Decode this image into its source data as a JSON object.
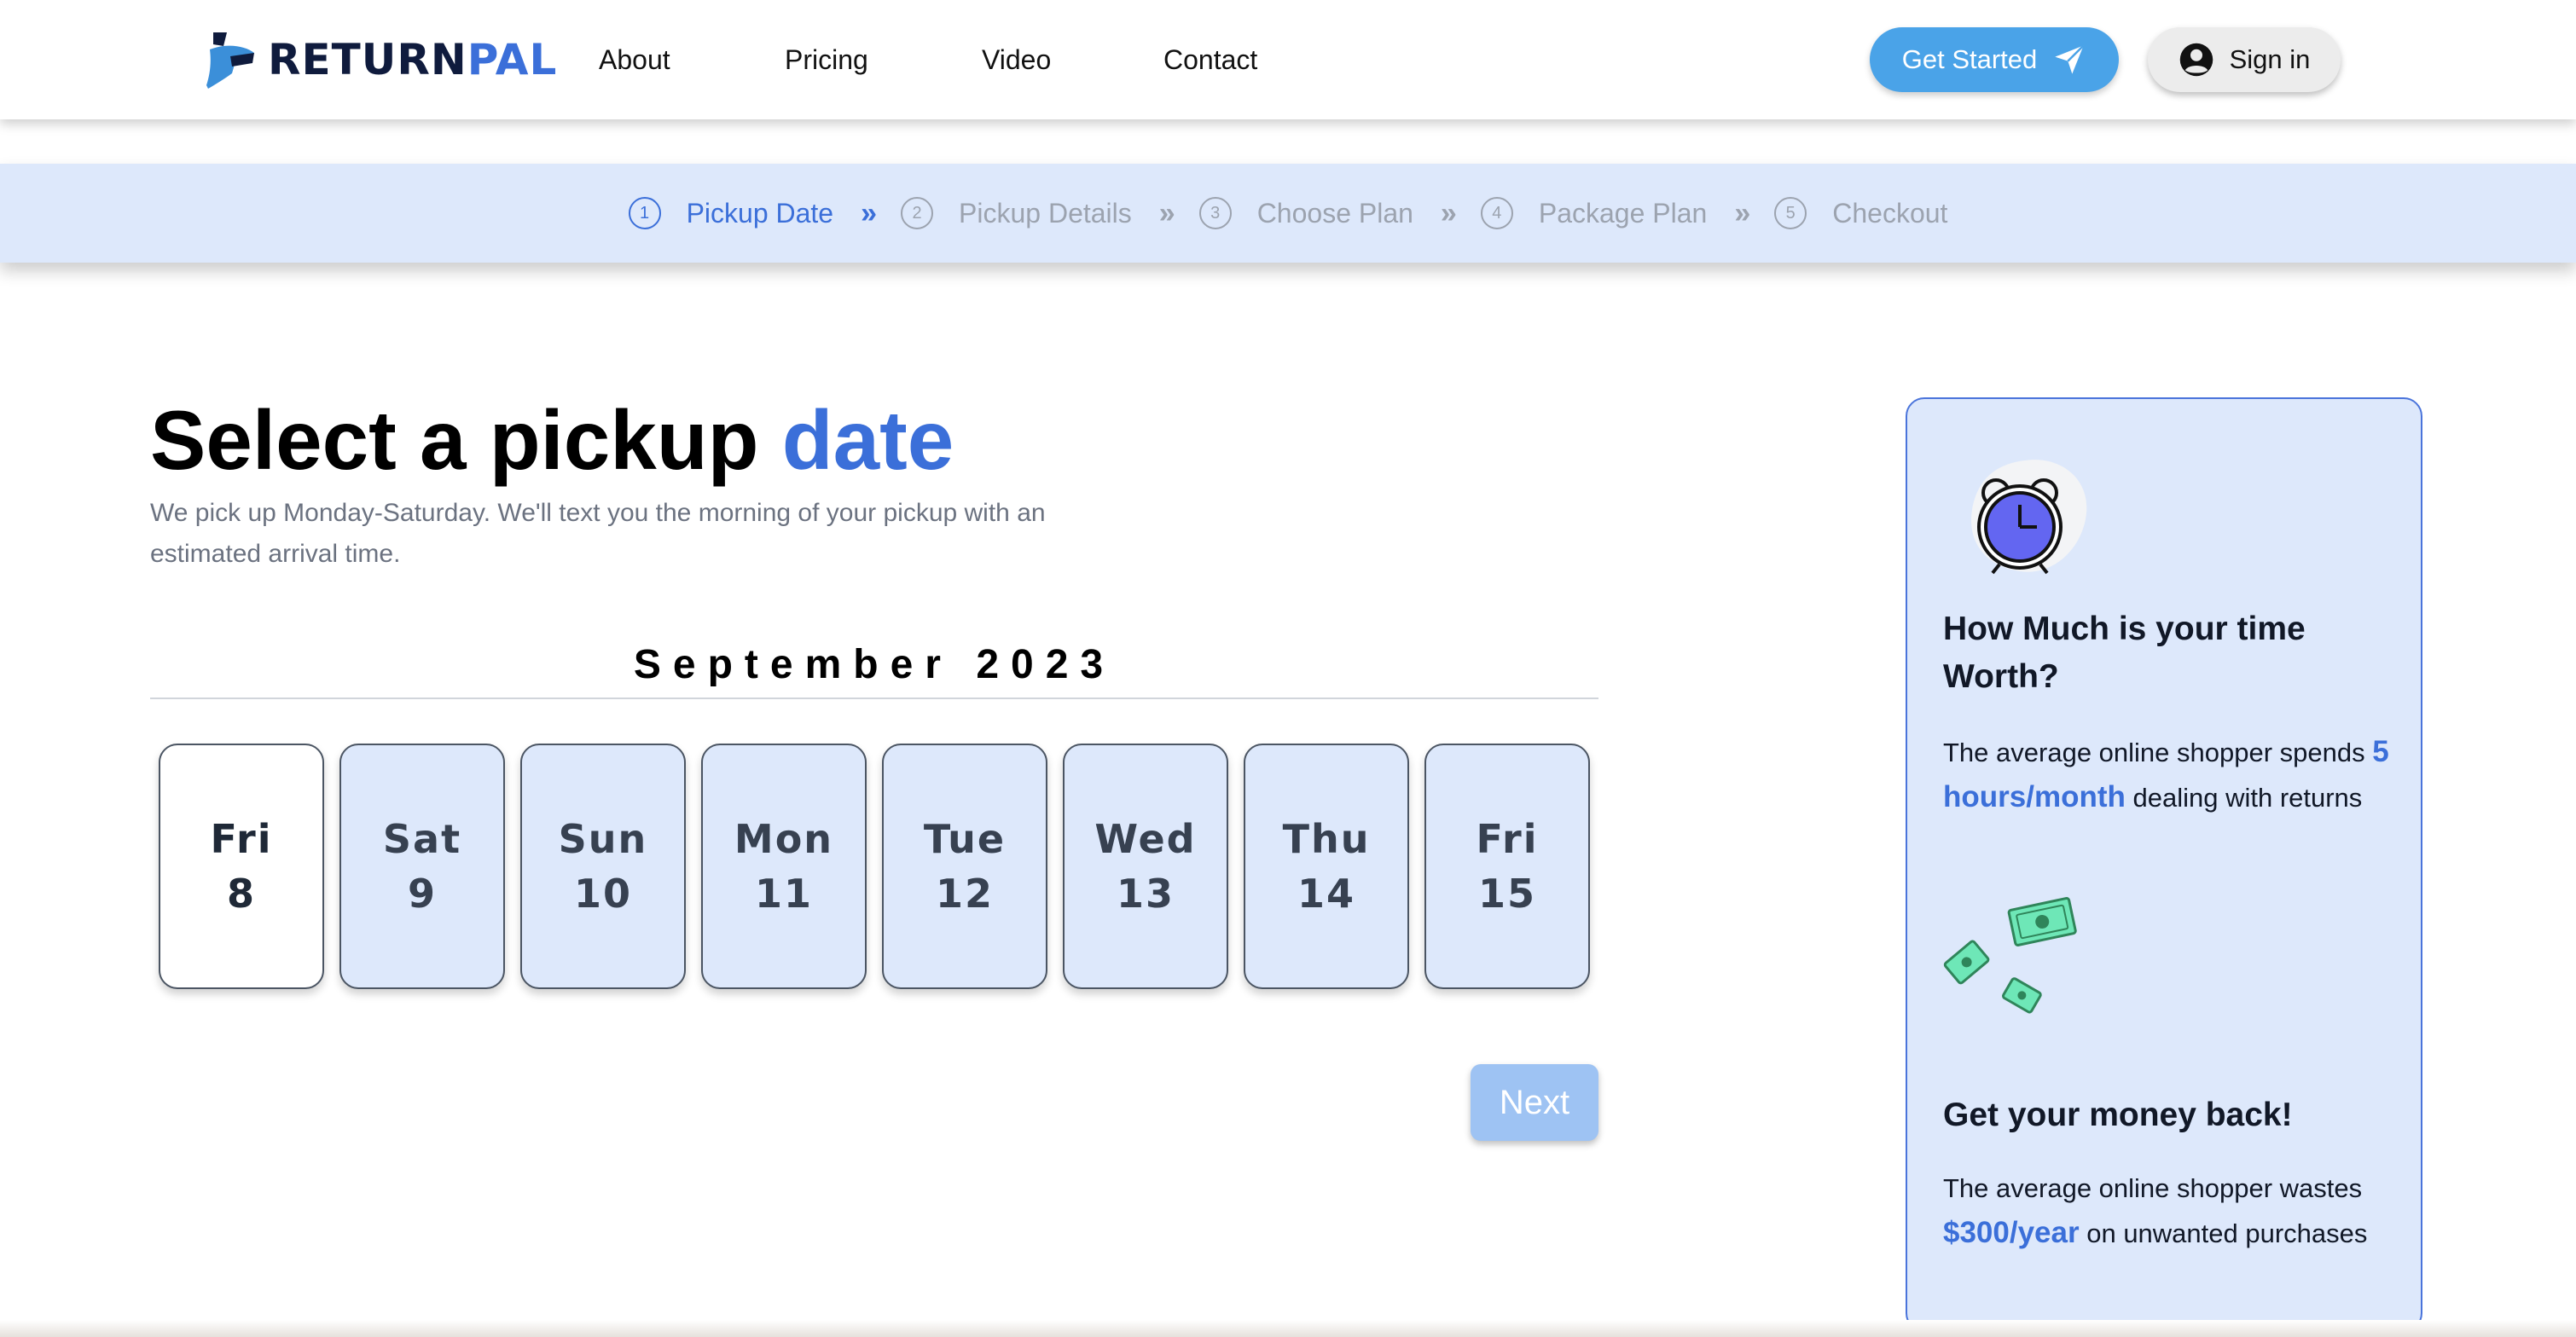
{
  "brand": {
    "name_part1": "RETURN",
    "name_part2": "PAL",
    "color_dark": "#0f1b3d",
    "color_accent": "#3b6fd9"
  },
  "nav": {
    "links": [
      {
        "label": "About"
      },
      {
        "label": "Pricing"
      },
      {
        "label": "Video"
      },
      {
        "label": "Contact"
      }
    ],
    "get_started_label": "Get Started",
    "get_started_icon": "send-icon",
    "sign_in_label": "Sign in",
    "sign_in_icon": "user-circle-icon"
  },
  "stepper": {
    "steps": [
      {
        "num": "1",
        "label": "Pickup Date",
        "active": true
      },
      {
        "num": "2",
        "label": "Pickup Details",
        "active": false
      },
      {
        "num": "3",
        "label": "Choose Plan",
        "active": false
      },
      {
        "num": "4",
        "label": "Package Plan",
        "active": false
      },
      {
        "num": "5",
        "label": "Checkout",
        "active": false
      }
    ],
    "separator": "»"
  },
  "main": {
    "heading_prefix": "Select a pickup ",
    "heading_accent": "date",
    "subtext": "We pick up Monday-Saturday. We'll text you the morning of your pickup with an estimated arrival time.",
    "month": "September 2023",
    "dates": [
      {
        "dow": "Fri",
        "day": "8",
        "selected": true
      },
      {
        "dow": "Sat",
        "day": "9",
        "selected": false
      },
      {
        "dow": "Sun",
        "day": "10",
        "selected": false
      },
      {
        "dow": "Mon",
        "day": "11",
        "selected": false
      },
      {
        "dow": "Tue",
        "day": "12",
        "selected": false
      },
      {
        "dow": "Wed",
        "day": "13",
        "selected": false
      },
      {
        "dow": "Thu",
        "day": "14",
        "selected": false
      },
      {
        "dow": "Fri",
        "day": "15",
        "selected": false
      }
    ],
    "next_label": "Next"
  },
  "side": {
    "clock_icon": "alarm-clock-icon",
    "title1": "How Much is your time Worth?",
    "text1_pre": "The average online shopper spends ",
    "text1_hl": "5 hours/month",
    "text1_post": " dealing with returns",
    "money_icon": "money-icon",
    "title2": "Get your money back!",
    "text2_pre": "The average online shopper wastes ",
    "text2_hl": "$300/year",
    "text2_post": " on unwanted purchases"
  },
  "colors": {
    "primary_button": "#4aa3e8",
    "light_blue_bg": "#dde8fb",
    "next_disabled": "#9ec3f3"
  }
}
